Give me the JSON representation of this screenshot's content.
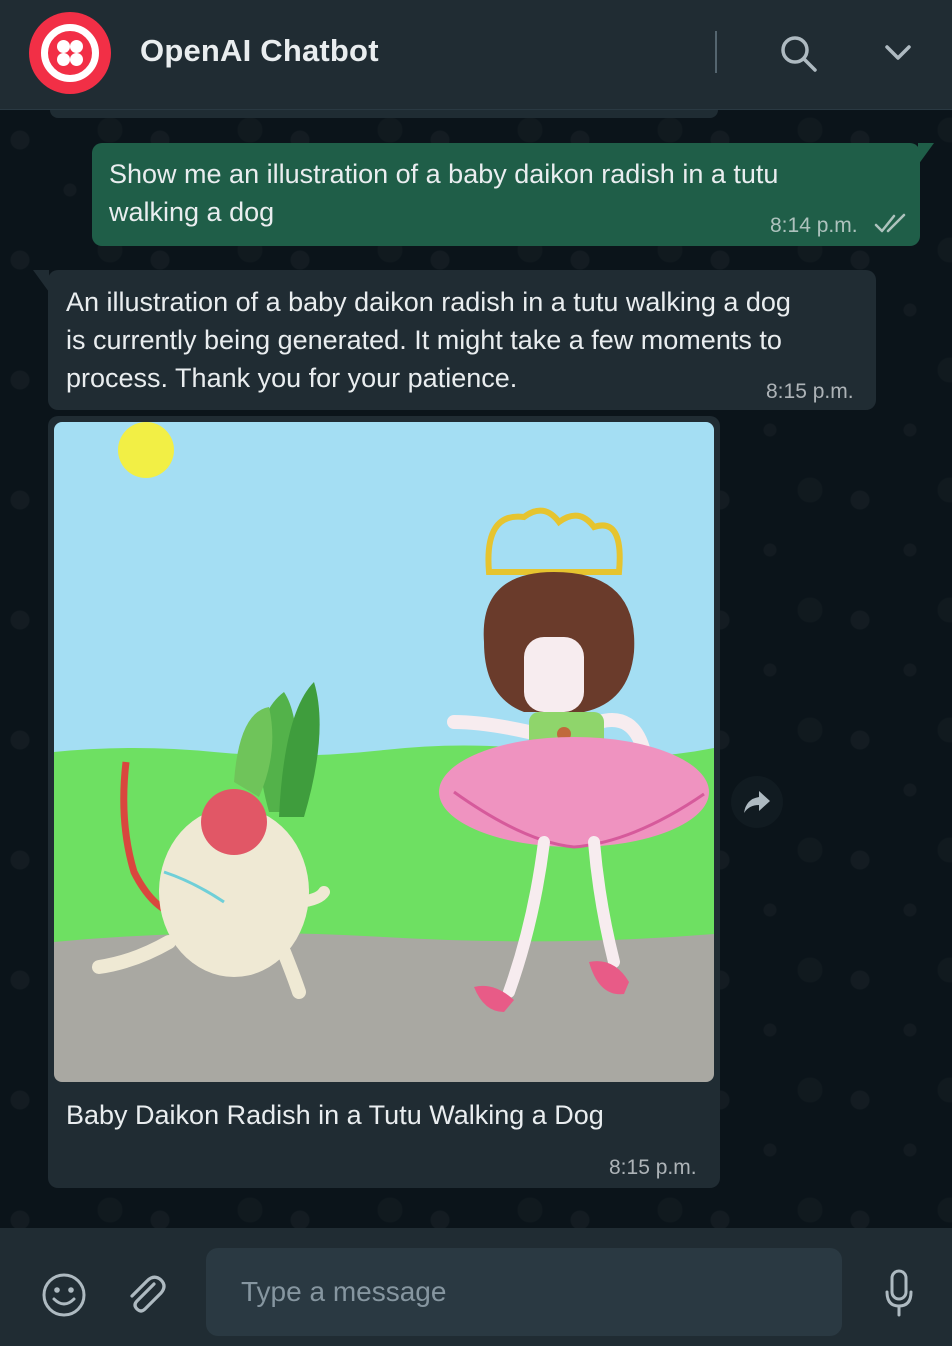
{
  "header": {
    "title": "OpenAI Chatbot",
    "avatar_icon": "twilio-logo-icon",
    "search_icon": "search-icon",
    "menu_icon": "chevron-down-icon"
  },
  "messages": [
    {
      "direction": "outgoing",
      "text_line1": "Show me an illustration of a baby daikon radish in a tutu",
      "text_line2": "walking a dog",
      "time": "8:14 p.m.",
      "status_icon": "double-check-icon"
    },
    {
      "direction": "incoming",
      "text_line1": "An illustration of a baby daikon radish in a tutu walking a dog",
      "text_line2": "is currently being generated. It might take a few moments to",
      "text_line3": "process. Thank you for your patience.",
      "time": "8:15 p.m."
    },
    {
      "direction": "incoming",
      "type": "image",
      "caption": "Baby Daikon Radish in a Tutu Walking a Dog",
      "time": "8:15 p.m.",
      "forward_icon": "forward-icon"
    }
  ],
  "composer": {
    "placeholder": "Type a message",
    "emoji_icon": "emoji-icon",
    "attach_icon": "paperclip-icon",
    "mic_icon": "microphone-icon"
  },
  "colors": {
    "header_bg": "#202c33",
    "chat_bg": "#0b141a",
    "outgoing_bubble": "#1f5e48",
    "incoming_bubble": "#202c33",
    "brand": "#f22f46"
  }
}
